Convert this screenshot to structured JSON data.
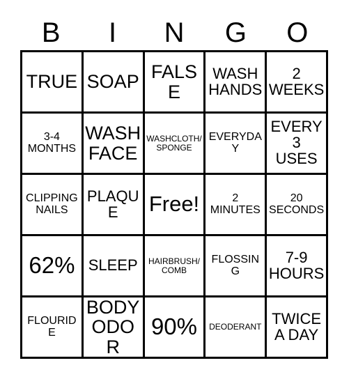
{
  "card": {
    "header_letters": [
      "B",
      "I",
      "N",
      "G",
      "O"
    ],
    "columns": 5,
    "rows": 5,
    "free_space": "Free!",
    "border_color": "#000000",
    "background_color": "#ffffff",
    "text_color": "#000000",
    "cells": [
      [
        {
          "text": "TRUE",
          "size": "sz-lg"
        },
        {
          "text": "SOAP",
          "size": "sz-lg"
        },
        {
          "text": "FALSE",
          "size": "sz-lg"
        },
        {
          "text": "WASH\nHANDS",
          "size": "sz-md"
        },
        {
          "text": "2\nWEEKS",
          "size": "sz-md"
        }
      ],
      [
        {
          "text": "3-4\nMONTHS",
          "size": "sz-sm"
        },
        {
          "text": "WASH\nFACE",
          "size": "sz-lg"
        },
        {
          "text": "WASHCLOTH/\nSPONGE",
          "size": "sz-xs"
        },
        {
          "text": "EVERYDAY",
          "size": "sz-sm"
        },
        {
          "text": "EVERY\n3\nUSES",
          "size": "sz-md"
        }
      ],
      [
        {
          "text": "CLIPPING\nNAILS",
          "size": "sz-sm"
        },
        {
          "text": "PLAQUE",
          "size": "sz-md"
        },
        {
          "text": "Free!",
          "size": "sz-free"
        },
        {
          "text": "2\nMINUTES",
          "size": "sz-sm"
        },
        {
          "text": "20\nSECONDS",
          "size": "sz-sm"
        }
      ],
      [
        {
          "text": "62%",
          "size": "sz-xl"
        },
        {
          "text": "SLEEP",
          "size": "sz-md"
        },
        {
          "text": "HAIRBRUSH/\nCOMB",
          "size": "sz-xs"
        },
        {
          "text": "FLOSSING",
          "size": "sz-sm"
        },
        {
          "text": "7-9\nHOURS",
          "size": "sz-md"
        }
      ],
      [
        {
          "text": "FLOURIDE",
          "size": "sz-sm"
        },
        {
          "text": "BODY\nODOR",
          "size": "sz-lg"
        },
        {
          "text": "90%",
          "size": "sz-xl"
        },
        {
          "text": "DEODERANT",
          "size": "sz-xs"
        },
        {
          "text": "TWICE\nA DAY",
          "size": "sz-md"
        }
      ]
    ]
  }
}
